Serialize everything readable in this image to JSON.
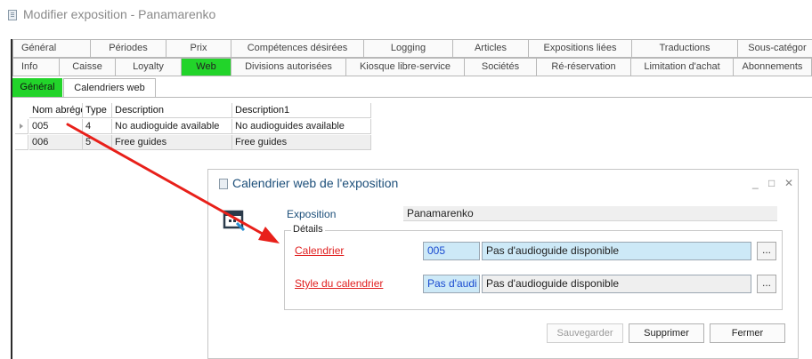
{
  "window": {
    "title": "Modifier exposition - Panamarenko"
  },
  "tabs_row1": [
    {
      "label": "Général"
    },
    {
      "label": "Périodes"
    },
    {
      "label": "Prix"
    },
    {
      "label": "Compétences désirées"
    },
    {
      "label": "Logging"
    },
    {
      "label": "Articles"
    },
    {
      "label": "Expositions liées"
    },
    {
      "label": "Traductions"
    },
    {
      "label": "Sous-catégor"
    }
  ],
  "tabs_row2": [
    {
      "label": "Info"
    },
    {
      "label": "Caisse"
    },
    {
      "label": "Loyalty"
    },
    {
      "label": "Web",
      "active": true
    },
    {
      "label": "Divisions autorisées"
    },
    {
      "label": "Kiosque libre-service"
    },
    {
      "label": "Sociétés"
    },
    {
      "label": "Ré-réservation"
    },
    {
      "label": "Limitation d'achat"
    },
    {
      "label": "Abonnements"
    }
  ],
  "subtabs": [
    {
      "label": "Général"
    },
    {
      "label": "Calendriers web"
    }
  ],
  "grid": {
    "columns": [
      "Nom abrégé",
      "Type",
      "Description",
      "Description1"
    ],
    "rows": [
      [
        "005",
        "4",
        "No audioguide available",
        "No audioguides available"
      ],
      [
        "006",
        "5",
        "Free guides",
        "Free guides"
      ]
    ]
  },
  "dialog": {
    "title": "Calendrier web de l'exposition",
    "minimize": "_",
    "maximize": "□",
    "close": "✕",
    "exposition_label": "Exposition",
    "exposition_value": "Panamarenko",
    "details_legend": "Détails",
    "calendrier_label": "Calendrier",
    "calendrier_code": "005",
    "calendrier_desc": "Pas d'audioguide disponible",
    "style_label": "Style du calendrier",
    "style_code": "Pas d'audi",
    "style_desc": "Pas d'audioguide disponible",
    "ellipsis": "...",
    "buttons": {
      "save": "Sauvegarder",
      "delete": "Supprimer",
      "close": "Fermer"
    }
  },
  "colors": {
    "active_tab": "#22d42a",
    "required_label": "#e02020",
    "arrow": "#e8201a",
    "field_bg": "#cde9f7"
  },
  "icons": [
    "window-icon",
    "row-pointer-icon",
    "exhibit-calendar-icon",
    "ellipsis-icon"
  ]
}
